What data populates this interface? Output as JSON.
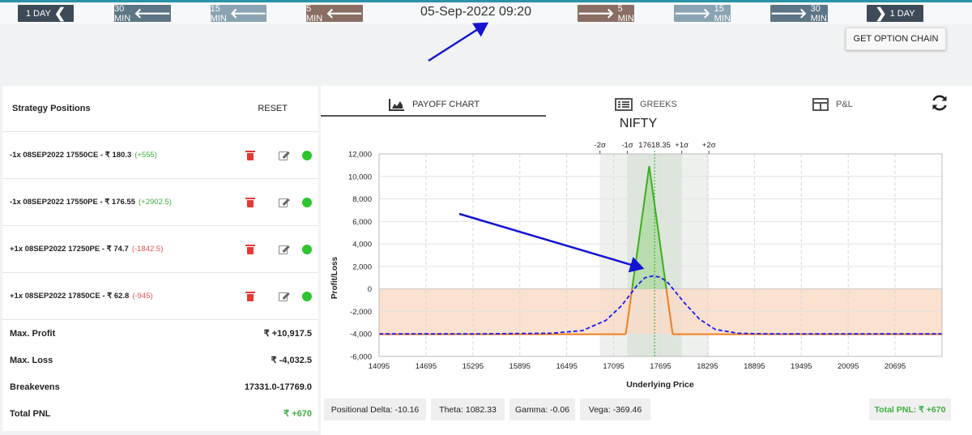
{
  "time_nav": {
    "back_1day": "1 DAY",
    "back_30min": "30 MIN",
    "back_15min": "15 MIN",
    "back_5min": "5 MIN",
    "fwd_5min": "5 MIN",
    "fwd_15min": "15 MIN",
    "fwd_30min": "30 MIN",
    "fwd_1day": "1 DAY",
    "datetime": "05-Sep-2022 09:20"
  },
  "option_chain_button": "GET OPTION CHAIN",
  "strategy": {
    "title": "Strategy Positions",
    "reset_label": "RESET",
    "positions": [
      {
        "text": "-1x  08SEP2022  17550CE  - ₹ 180.3",
        "pnl": "(+555)"
      },
      {
        "text": "-1x  08SEP2022  17550PE  - ₹ 176.55",
        "pnl": "(+2902.5)"
      },
      {
        "text": "+1x  08SEP2022  17250PE  - ₹ 74.7",
        "pnl": "(-1842.5)"
      },
      {
        "text": "+1x  08SEP2022  17850CE  - ₹ 62.8",
        "pnl": "(-945)"
      }
    ],
    "summary": {
      "max_profit_label": "Max. Profit",
      "max_profit": "₹ +10,917.5",
      "max_loss_label": "Max. Loss",
      "max_loss": "₹ -4,032.5",
      "breakevens_label": "Breakevens",
      "breakevens": "17331.0-17769.0",
      "total_pnl_label": "Total PNL",
      "total_pnl": "₹ +670"
    }
  },
  "tabs": {
    "payoff": "PAYOFF CHART",
    "greeks": "GREEKS",
    "pnl": "P&L"
  },
  "metrics": {
    "delta": "Positional Delta: -10.16",
    "theta": "Theta: 1082.33",
    "gamma": "Gamma: -0.06",
    "vega": "Vega: -369.46",
    "total_pnl": "Total PNL: ₹ +670"
  },
  "colors": {
    "expiry_profit": "#3dae1e",
    "expiry_loss": "#ee7f1f",
    "current_curve": "#1a1aee",
    "loss_zone": "#f9dcc8",
    "arrow": "#1414d2"
  },
  "chart_data": {
    "type": "line",
    "title": "NIFTY",
    "xlabel": "Underlying Price",
    "ylabel": "Profit/Loss",
    "xlim": [
      14095,
      21295
    ],
    "ylim": [
      -6000,
      12000
    ],
    "x_ticks": [
      "14095",
      "14695",
      "15295",
      "15895",
      "16495",
      "17095",
      "17695",
      "18295",
      "18895",
      "19495",
      "20095",
      "20695"
    ],
    "y_ticks": [
      "12,000",
      "10,000",
      "8,000",
      "6,000",
      "4,000",
      "2,000",
      "0",
      "-2,000",
      "-4,000",
      "-6,000"
    ],
    "spot": 17618.35,
    "spot_label": "17618.35",
    "sigma_labels": [
      "-2σ",
      "-1σ",
      "+1σ",
      "+2σ"
    ],
    "sigma_levels": [
      16920,
      17270,
      17966,
      18314
    ],
    "series": [
      {
        "values": [
          [
            14095,
            -4032.5
          ],
          [
            17250,
            -4032.5
          ],
          [
            17550,
            10917.5
          ],
          [
            17850,
            -4032.5
          ],
          [
            21295,
            -4032.5
          ]
        ]
      },
      {
        "values": [
          [
            14095,
            -4000
          ],
          [
            15295,
            -4000
          ],
          [
            16295,
            -3940
          ],
          [
            16695,
            -3700
          ],
          [
            16995,
            -2800
          ],
          [
            17195,
            -1500
          ],
          [
            17395,
            300
          ],
          [
            17495,
            1000
          ],
          [
            17595,
            1150
          ],
          [
            17695,
            1050
          ],
          [
            17795,
            500
          ],
          [
            17995,
            -1200
          ],
          [
            18195,
            -2700
          ],
          [
            18395,
            -3600
          ],
          [
            18695,
            -3950
          ],
          [
            19095,
            -4000
          ],
          [
            21295,
            -4000
          ]
        ]
      }
    ]
  }
}
